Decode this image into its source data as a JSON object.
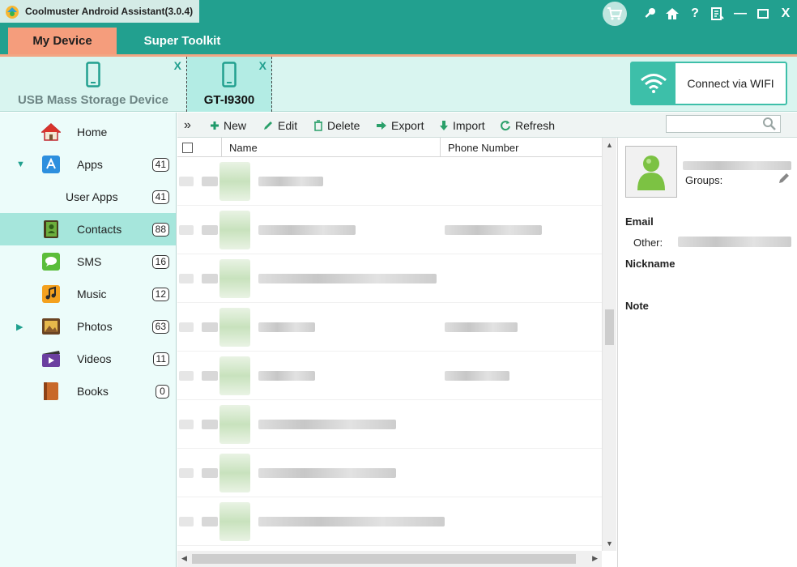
{
  "app": {
    "title": "Coolmuster Android Assistant(3.0.4)"
  },
  "title_actions": [
    "cart-icon",
    "key-icon",
    "home-icon",
    "help-icon",
    "register-icon",
    "minimize-icon",
    "maximize-icon",
    "close-icon"
  ],
  "title_glyphs": {
    "help": "?",
    "minimize": "—",
    "close": "X"
  },
  "main_tabs": [
    {
      "label": "My Device",
      "active": true
    },
    {
      "label": "Super Toolkit",
      "active": false
    }
  ],
  "devices": [
    {
      "label": "USB Mass Storage Device",
      "active": false,
      "close": "X"
    },
    {
      "label": "GT-I9300",
      "active": true,
      "close": "X"
    }
  ],
  "wifi": {
    "label": "Connect via WIFI"
  },
  "sidebar": {
    "items": [
      {
        "label": "Home",
        "icon": "home-icon",
        "count": "",
        "expand": ""
      },
      {
        "label": "Apps",
        "icon": "apps-icon",
        "count": "41",
        "expand": "▼"
      },
      {
        "label": "User Apps",
        "icon": "",
        "count": "41",
        "expand": ""
      },
      {
        "label": "Contacts",
        "icon": "contacts-icon",
        "count": "88",
        "expand": "",
        "selected": true
      },
      {
        "label": "SMS",
        "icon": "sms-icon",
        "count": "16",
        "expand": ""
      },
      {
        "label": "Music",
        "icon": "music-icon",
        "count": "12",
        "expand": ""
      },
      {
        "label": "Photos",
        "icon": "photos-icon",
        "count": "63",
        "expand": "▶"
      },
      {
        "label": "Videos",
        "icon": "videos-icon",
        "count": "11",
        "expand": ""
      },
      {
        "label": "Books",
        "icon": "books-icon",
        "count": "0",
        "expand": ""
      }
    ]
  },
  "toolbar": {
    "collapse": "»",
    "new": "New",
    "edit": "Edit",
    "delete": "Delete",
    "export": "Export",
    "import": "Import",
    "refresh": "Refresh"
  },
  "list": {
    "columns": [
      "Name",
      "Phone Number"
    ],
    "row_count_visible": 8
  },
  "detail": {
    "groups_label": "Groups:",
    "email_title": "Email",
    "other_label": "Other:",
    "nickname_title": "Nickname",
    "note_title": "Note"
  },
  "colors": {
    "accent": "#22a08f",
    "active_tab": "#f59d7c",
    "sidebar_selected": "#a6e6dc"
  }
}
